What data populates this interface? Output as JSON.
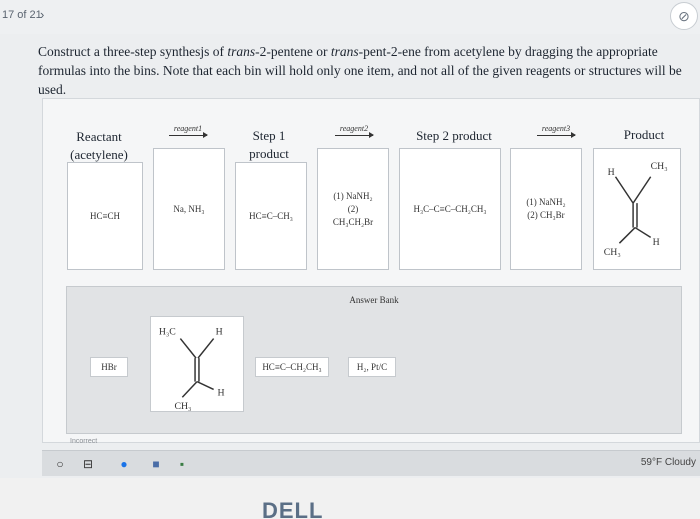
{
  "nav": {
    "counter": "17 of 21",
    "next_arrow": "›",
    "flag_icon": "flag-icon"
  },
  "question": {
    "text_parts": [
      "Construct a three-step synthesjs of ",
      "trans",
      "-2-pentene or ",
      "trans",
      "-pent-2-ene from acetylene by dragging the appropriate formulas into the bins. Note that each bin will hold only one item, and not all of the given reagents or structures will be used."
    ]
  },
  "scheme": {
    "reactant_header": "Reactant\n(acetylene)",
    "reactant_value": "HC≡CH",
    "reagent1_label": "reagent1",
    "reagent1_value": "Na, NH₃",
    "step1_header": "Step 1\nproduct",
    "step1_value": "HC≡C–CH₃",
    "reagent2_label": "reagent2",
    "reagent2_value": "(1) NaNH₂\n(2)\nCH₃CH₂Br",
    "step2_header": "Step 2 product",
    "step2_value": "H₃C–C≡C–CH₂CH₃",
    "reagent3_label": "reagent3",
    "reagent3_value": "(1) NaNH₂\n(2) CH₃Br",
    "product_header": "Product",
    "product_structure": {
      "top_left": "H",
      "top_right": "CH₃",
      "bottom_right": "H",
      "bottom_left": "CH₃"
    }
  },
  "answer_bank": {
    "title": "Answer Bank",
    "items": [
      "HBr",
      "HC≡C–CH₂CH₃",
      "H₂, Pt/C"
    ],
    "structure": {
      "top_left": "H₃C",
      "top_right": "H",
      "bottom_right": "H",
      "bottom_left": "CH₃"
    }
  },
  "status": "Incorrect",
  "taskbar": {
    "weather": "59°F  Cloudy"
  },
  "bezel": {
    "brand": "DELL"
  }
}
